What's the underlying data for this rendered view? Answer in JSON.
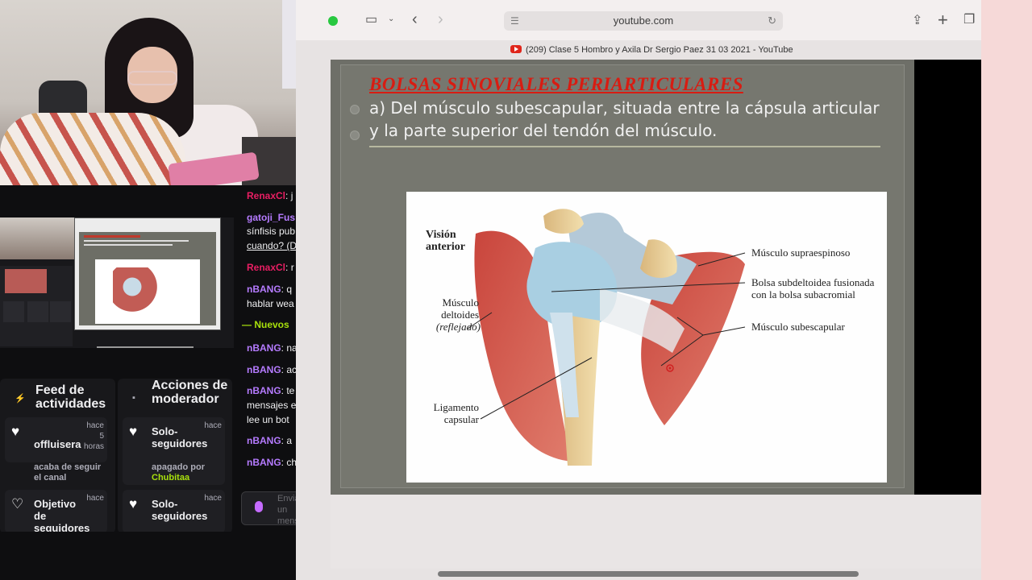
{
  "browser": {
    "url": "youtube.com",
    "tab_title": "(209) Clase 5 Hombro y Axila Dr Sergio Paez 31 03 2021 - YouTube"
  },
  "slide": {
    "title": "BOLSAS SINOVIALES PERIARTICULARES",
    "text": "a) Del músculo subescapular, situada entre la cápsula articular y la parte superior del tendón del músculo."
  },
  "diagram": {
    "view": "Visión anterior",
    "deltoid": "Músculo deltoides",
    "deltoid_note": "(reflejado)",
    "ligament": "Ligamento capsular",
    "supraspinatus": "Músculo supraespinoso",
    "bursa": "Bolsa subdeltoidea fusionada con la bolsa subacromial",
    "subscapularis": "Músculo subescapular"
  },
  "panels": {
    "feed_title": "Feed de actividades",
    "mod_title": "Acciones de moderador",
    "feed_items": [
      {
        "name": "offluisera",
        "time": "hace 5 horas",
        "desc": "acaba de seguir el canal"
      },
      {
        "name": "Objetivo de seguidores",
        "time": "hace",
        "desc": ""
      }
    ],
    "mod_items": [
      {
        "name": "Solo-seguidores",
        "time": "hace",
        "desc": "apagado por",
        "actor": "Chubitaa"
      },
      {
        "name": "Solo-seguidores",
        "time": "hace",
        "desc": ""
      }
    ]
  },
  "chat": {
    "messages": [
      {
        "user": "RenaxCl",
        "color": "#e91e63",
        "text": ": j"
      },
      {
        "user": "gatoji_Fus",
        "color": "#b57bff",
        "text": ""
      },
      {
        "user": "",
        "color": "",
        "text": "sínfisis pub"
      },
      {
        "user": "",
        "color": "",
        "text": "cuando? (D"
      },
      {
        "user": "RenaxCl",
        "color": "#e91e63",
        "text": ": r"
      },
      {
        "user": "nBANG",
        "color": "#b57bff",
        "text": ": q"
      },
      {
        "user": "",
        "color": "",
        "text": "hablar wea"
      },
      {
        "user": "nBANG",
        "color": "#b57bff",
        "text": ": na"
      },
      {
        "user": "nBANG",
        "color": "#b57bff",
        "text": ": ac"
      },
      {
        "user": "nBANG",
        "color": "#b57bff",
        "text": ": te"
      },
      {
        "user": "",
        "color": "",
        "text": "mensajes e"
      },
      {
        "user": "",
        "color": "",
        "text": "lee un bot"
      },
      {
        "user": "nBANG",
        "color": "#b57bff",
        "text": ": a"
      },
      {
        "user": "nBANG",
        "color": "#b57bff",
        "text": ": ch"
      }
    ],
    "divider": "— Nuevos",
    "input_placeholder": "Enviar un mensaje"
  },
  "colors": {
    "twitch_green": "#a8e10c",
    "slide_red": "#d81c12",
    "youtube_red": "#e0261b"
  }
}
